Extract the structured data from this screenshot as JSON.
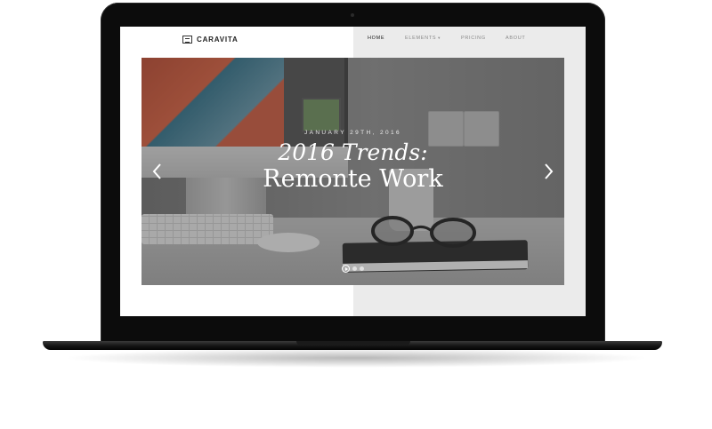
{
  "brand": {
    "name": "CARAVITA",
    "icon": "logo-icon"
  },
  "nav": {
    "items": [
      {
        "label": "HOME",
        "active": true
      },
      {
        "label": "ELEMENTS",
        "has_dropdown": true,
        "dropdown_icon": "caret-down-icon"
      },
      {
        "label": "PRICING"
      },
      {
        "label": "ABOUT"
      }
    ]
  },
  "hero": {
    "date": "JANUARY 29TH, 2016",
    "title_line1": "2016 Trends:",
    "title_line2": "Remonte Work",
    "prev_icon": "chevron-left-icon",
    "next_icon": "chevron-right-icon",
    "pagination": {
      "play_icon": "play-icon",
      "total_dots": 3
    }
  },
  "colors": {
    "frame": "#0c0c0c",
    "nav_active": "#222222",
    "nav_inactive": "#8a8a8a",
    "hero_text": "#ffffff"
  }
}
